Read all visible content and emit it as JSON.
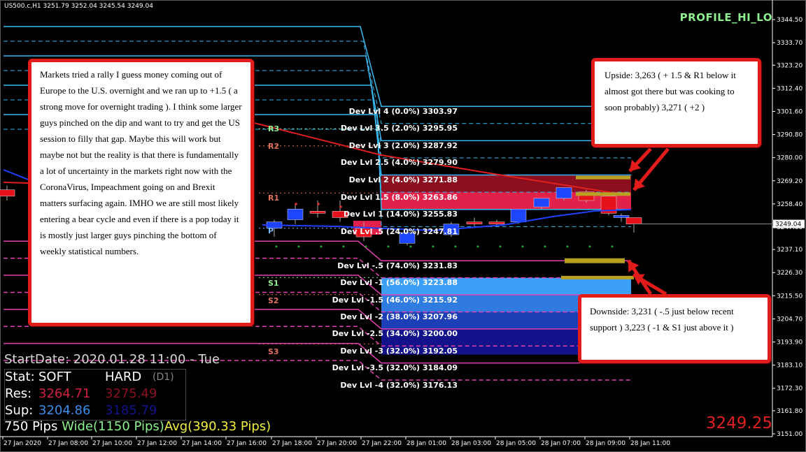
{
  "symbol_info": "US500.c,H1  3251.79 3252.04 3245.54 3249.04",
  "profile_title": "PROFILE_HI_LO",
  "current_price_big": "3249.25",
  "current_price_tag": "3249.04",
  "notes": {
    "main": "Markets tried a rally I guess money coming out of Europe to the U.S. overnight and we ran up to +1.5 ( a strong move for overnight trading ). I think some larger guys pinched on the dip and want to try and get the US session to filly that gap. Maybe this will work but maybe not but the reality is that there is fundamentally a lot of uncertainty in the markets right now with the CoronaVirus, Impeachment going on and Brexit matters surfacing again.  IMHO we are still most likely entering a bear cycle and even if there is a pop today it is mostly just larger guys pinching the bottom of weekly statistical numbers.",
    "upside": "Upside: 3,263 ( + 1.5 & R1 below it almost got there but was cooking to soon probably) 3,271 ( +2 )",
    "downside": "Downside: 3,231 ( -.5 just below recent support ) 3,223 ( -1 & S1 just above it )"
  },
  "stats": {
    "start_date": "StartDate: 2020.01.28 11:00 - Tue",
    "stat_label": "Stat:",
    "soft_label": "SOFT",
    "hard_label": "HARD",
    "timeframe": "(D1)",
    "res_label": "Res:",
    "res_soft": "3264.71",
    "res_hard": "3275.49",
    "sup_label": "Sup:",
    "sup_soft": "3204.86",
    "sup_hard": "3185.79",
    "pips": "750 Pips",
    "wide": "Wide(1150 Pips)",
    "avg": "Avg(390.33 Pips)"
  },
  "colors": {
    "res_soft": "#d02040",
    "res_hard": "#8a1020",
    "sup_soft": "#3a8ee8",
    "sup_hard": "#13138a",
    "wide": "#8ef08e",
    "avg": "#f0f040"
  },
  "chart_data": {
    "type": "candlestick",
    "ylim": [
      3151.0,
      3349.0
    ],
    "price_ticks": [
      "3344.50",
      "3333.70",
      "3323.20",
      "3312.40",
      "3301.60",
      "3290.80",
      "3280.00",
      "3269.20",
      "3258.40",
      "3247.60",
      "3237.10",
      "3226.30",
      "3215.50",
      "3204.70",
      "3193.90",
      "3183.10",
      "3172.30",
      "3161.80",
      "3151.00"
    ],
    "time_labels": [
      "27 Jan 2020",
      "27 Jan 08:00",
      "27 Jan 10:00",
      "27 Jan 12:00",
      "27 Jan 14:00",
      "27 Jan 16:00",
      "27 Jan 18:00",
      "27 Jan 20:00",
      "27 Jan 22:00",
      "28 Jan 01:00",
      "28 Jan 03:00",
      "28 Jan 05:00",
      "28 Jan 07:00",
      "28 Jan 09:00",
      "28 Jan 11:00"
    ],
    "dev_levels": [
      {
        "label": "Dev Lvl 4 (0.0%) 3303.97",
        "value": 3303.97
      },
      {
        "label": "Dev Lvl 3.5 (2.0%) 3295.95",
        "value": 3295.95
      },
      {
        "label": "Dev Lvl 3 (2.0%) 3287.92",
        "value": 3287.92
      },
      {
        "label": "Dev Lvl 2.5 (4.0%) 3279.90",
        "value": 3279.9
      },
      {
        "label": "Dev Lvl 2 (4.0%) 3271.88",
        "value": 3271.88
      },
      {
        "label": "Dev Lvl 1.5 (8.0%) 3263.86",
        "value": 3263.86
      },
      {
        "label": "Dev Lvl 1 (14.0%) 3255.83",
        "value": 3255.83
      },
      {
        "label": "Dev Lvl .5 (24.0%) 3247.81",
        "value": 3247.81
      },
      {
        "label": "Dev Lvl -.5 (74.0%) 3231.83",
        "value": 3231.83
      },
      {
        "label": "Dev Lvl -1 (56.0%) 3223.88",
        "value": 3223.88
      },
      {
        "label": "Dev Lvl -1.5 (46.0%) 3215.92",
        "value": 3215.92
      },
      {
        "label": "Dev Lvl -2 (38.0%) 3207.96",
        "value": 3207.96
      },
      {
        "label": "Dev Lvl -2.5 (34.0%) 3200.00",
        "value": 3200.0
      },
      {
        "label": "Dev Lvl -3 (32.0%) 3192.05",
        "value": 3192.05
      },
      {
        "label": "Dev Lvl -3.5 (32.0%) 3184.09",
        "value": 3184.09
      },
      {
        "label": "Dev Lvl -4 (32.0%) 3176.13",
        "value": 3176.13
      }
    ],
    "pivots": [
      {
        "label": "R3",
        "value": 3293.5,
        "color": "#8ef08e"
      },
      {
        "label": "R2",
        "value": 3285.5,
        "color": "#e0705a"
      },
      {
        "label": "R1",
        "value": 3263.5,
        "color": "#e0705a"
      },
      {
        "label": "P",
        "value": 3247.0,
        "color": "#7ab8ff"
      },
      {
        "label": "S1",
        "value": 3224.0,
        "color": "#8ef08e"
      },
      {
        "label": "S2",
        "value": 3216.0,
        "color": "#e0705a"
      },
      {
        "label": "S3",
        "value": 3193.0,
        "color": "#e0705a"
      }
    ],
    "candles": [
      {
        "time": "27 Jan 2020",
        "o": 3265,
        "h": 3267,
        "l": 3260,
        "c": 3262
      },
      {
        "time": "27 Jan 17:00",
        "o": 3247,
        "h": 3251,
        "l": 3243,
        "c": 3250
      },
      {
        "time": "27 Jan 18:00",
        "o": 3251,
        "h": 3258,
        "l": 3249,
        "c": 3256
      },
      {
        "time": "27 Jan 19:00",
        "o": 3255,
        "h": 3260,
        "l": 3252,
        "c": 3254
      },
      {
        "time": "27 Jan 20:00",
        "o": 3255,
        "h": 3260,
        "l": 3250,
        "c": 3252
      },
      {
        "time": "27 Jan 21:00",
        "o": 3247,
        "h": 3250,
        "l": 3241,
        "c": 3243
      },
      {
        "time": "28 Jan 01:00",
        "o": 3240,
        "h": 3246,
        "l": 3239,
        "c": 3245
      },
      {
        "time": "28 Jan 02:00",
        "o": 3244,
        "h": 3250,
        "l": 3243,
        "c": 3249
      },
      {
        "time": "28 Jan 03:00",
        "o": 3250,
        "h": 3252,
        "l": 3248,
        "c": 3249
      },
      {
        "time": "28 Jan 04:00",
        "o": 3250,
        "h": 3251,
        "l": 3248,
        "c": 3249
      },
      {
        "time": "28 Jan 05:00",
        "o": 3250,
        "h": 3256,
        "l": 3249,
        "c": 3256
      },
      {
        "time": "28 Jan 06:00",
        "o": 3257,
        "h": 3261,
        "l": 3256,
        "c": 3261
      },
      {
        "time": "28 Jan 07:00",
        "o": 3261,
        "h": 3266,
        "l": 3260,
        "c": 3266
      },
      {
        "time": "28 Jan 08:00",
        "o": 3264,
        "h": 3265,
        "l": 3259,
        "c": 3260
      },
      {
        "time": "28 Jan 09:00",
        "o": 3262,
        "h": 3263,
        "l": 3253,
        "c": 3254
      },
      {
        "time": "28 Jan 10:00",
        "o": 3252,
        "h": 3254,
        "l": 3250,
        "c": 3253
      },
      {
        "time": "28 Jan 11:00",
        "o": 3252,
        "h": 3252,
        "l": 3245,
        "c": 3249
      }
    ]
  }
}
